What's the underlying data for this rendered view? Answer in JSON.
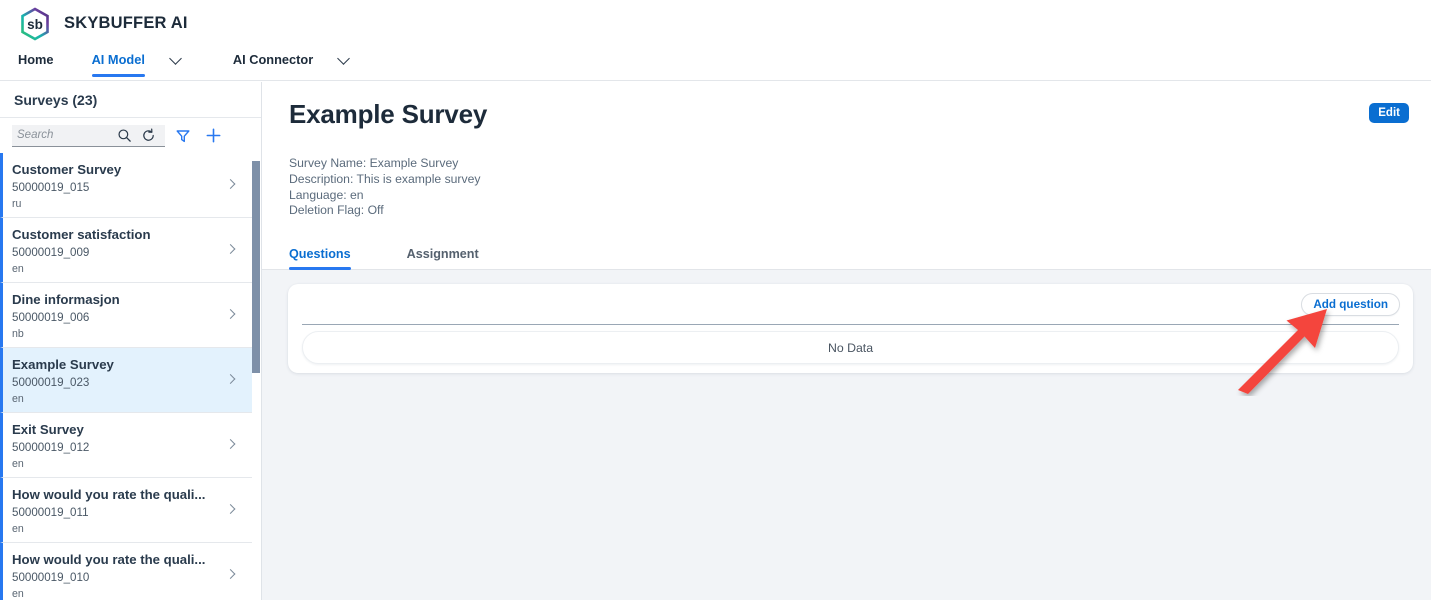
{
  "app": {
    "brand_name": "SKYBUFFER AI",
    "logo_text": "sb"
  },
  "nav": {
    "items": [
      {
        "label": "Home",
        "active": false,
        "has_dropdown": false
      },
      {
        "label": "AI Model",
        "active": true,
        "has_dropdown": true
      },
      {
        "label": "AI Connector",
        "active": false,
        "has_dropdown": true
      }
    ]
  },
  "sidebar": {
    "title": "Surveys (23)",
    "search": {
      "placeholder": "Search",
      "value": ""
    },
    "toolbar_icons": [
      "search-icon",
      "refresh-icon",
      "filter-icon",
      "add-icon"
    ],
    "items": [
      {
        "name": "Customer Survey",
        "id": "50000019_015",
        "lang": "ru",
        "selected": false
      },
      {
        "name": "Customer satisfaction",
        "id": "50000019_009",
        "lang": "en",
        "selected": false
      },
      {
        "name": "Dine informasjon",
        "id": "50000019_006",
        "lang": "nb",
        "selected": false
      },
      {
        "name": "Example Survey",
        "id": "50000019_023",
        "lang": "en",
        "selected": true
      },
      {
        "name": "Exit Survey",
        "id": "50000019_012",
        "lang": "en",
        "selected": false
      },
      {
        "name": "How would you rate the quali...",
        "id": "50000019_011",
        "lang": "en",
        "selected": false
      },
      {
        "name": "How would you rate the quali...",
        "id": "50000019_010",
        "lang": "en",
        "selected": false
      }
    ]
  },
  "main": {
    "page_title": "Example Survey",
    "edit_label": "Edit",
    "meta": [
      "Survey Name: Example Survey",
      "Description: This is example survey",
      "Language: en",
      "Deletion Flag: Off"
    ],
    "tabs": [
      {
        "label": "Questions",
        "active": true
      },
      {
        "label": "Assignment",
        "active": false
      }
    ],
    "card": {
      "add_question_label": "Add question",
      "empty_text": "No Data"
    }
  },
  "annotation": {
    "arrow_color": "#f4453c",
    "points_to": "add-question-button"
  },
  "colors": {
    "accent_blue": "#0a6ed1",
    "tab_underline": "#2878f0",
    "selected_row": "#e3f2fd",
    "content_bg": "#f2f4f7",
    "text_dark": "#1d2b3a"
  }
}
